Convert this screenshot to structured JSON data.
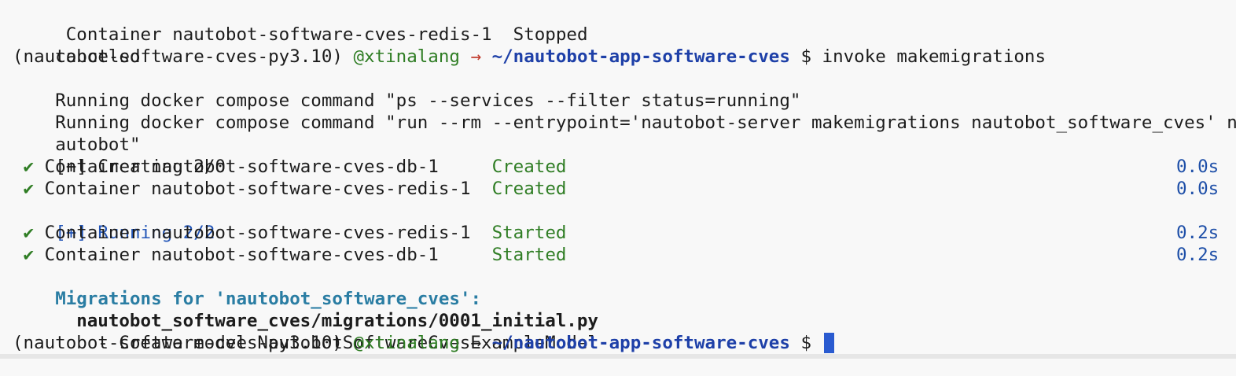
{
  "terminal": {
    "line1": {
      "text": " Container nautobot-software-cves-redis-1  Stopped"
    },
    "line2": {
      "text": "canceled"
    },
    "prompt1": {
      "env": "(nautobot-software-cves-py3.10)",
      "user": "@xtinalang",
      "arrow": "→",
      "path": "~/nautobot-app-software-cves",
      "dollar": "$",
      "command": "invoke makemigrations"
    },
    "line4": {
      "text": "Running docker compose command \"ps --services --filter status=running\""
    },
    "line5": {
      "text": "Running docker compose command \"run --rm --entrypoint='nautobot-server makemigrations nautobot_software_cves' n"
    },
    "line6": {
      "text": "autobot\""
    },
    "creating": {
      "text": "[+] Creating 2/0"
    },
    "created_rows": [
      {
        "check": "✔",
        "name": "Container nautobot-software-cves-db-1     ",
        "status": "Created",
        "time": "0.0s"
      },
      {
        "check": "✔",
        "name": "Container nautobot-software-cves-redis-1  ",
        "status": "Created",
        "time": "0.0s"
      }
    ],
    "running": {
      "text": "[+] Running 2/2"
    },
    "started_rows": [
      {
        "check": "✔",
        "name": "Container nautobot-software-cves-redis-1  ",
        "status": "Started",
        "time": "0.2s"
      },
      {
        "check": "✔",
        "name": "Container nautobot-software-cves-db-1     ",
        "status": "Started",
        "time": "0.2s"
      }
    ],
    "migrations_header": "Migrations for 'nautobot_software_cves':",
    "migration_file": "nautobot_software_cves/migrations/0001_initial.py",
    "migration_op": "- Create model NautobotSoftwareCvesExampleModel",
    "prompt2": {
      "env": "(nautobot-software-cves-py3.10)",
      "user": "@xtinalang",
      "arrow": "→",
      "path": "~/nautobot-app-software-cves",
      "dollar": "$"
    }
  },
  "colors": {
    "background": "#f8f8f8",
    "text": "#1c1c1c",
    "green": "#2f7d24",
    "red_arrow": "#c0392b",
    "path_blue": "#1e40a8",
    "running_blue": "#2356b8",
    "migrations_cyan": "#2a7da3",
    "cursor": "#2a5bd0"
  }
}
